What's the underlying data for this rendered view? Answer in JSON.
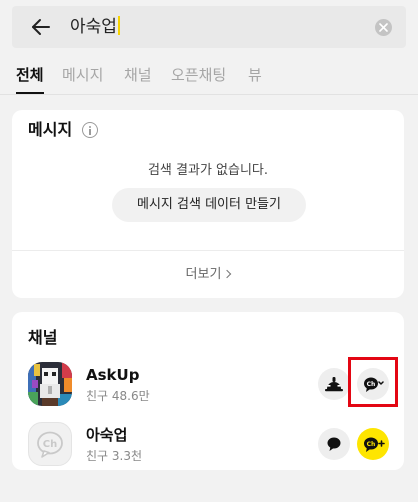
{
  "search": {
    "query": "아숙업"
  },
  "tabs": [
    {
      "label": "전체",
      "active": true
    },
    {
      "label": "메시지",
      "active": false
    },
    {
      "label": "채널",
      "active": false
    },
    {
      "label": "오픈채팅",
      "active": false
    },
    {
      "label": "뷰",
      "active": false
    }
  ],
  "messages_section": {
    "title": "메시지",
    "empty_text": "검색 결과가 없습니다.",
    "make_data_button": "메시지 검색 데이터 만들기",
    "more_link": "더보기"
  },
  "channels_section": {
    "title": "채널",
    "items": [
      {
        "name": "AskUp",
        "sub": "친구 48.6만",
        "avatar": "askup-pixel-avatar",
        "actions": [
          "bot-icon",
          "channel-chat-icon"
        ]
      },
      {
        "name": "아숙업",
        "sub": "친구 3.3천",
        "avatar": "channel-placeholder-avatar",
        "actions": [
          "chat-bubble-icon",
          "add-channel-icon"
        ]
      }
    ]
  },
  "colors": {
    "accent_yellow": "#fee500",
    "highlight_red": "#e30613",
    "background": "#f2f2f2"
  }
}
